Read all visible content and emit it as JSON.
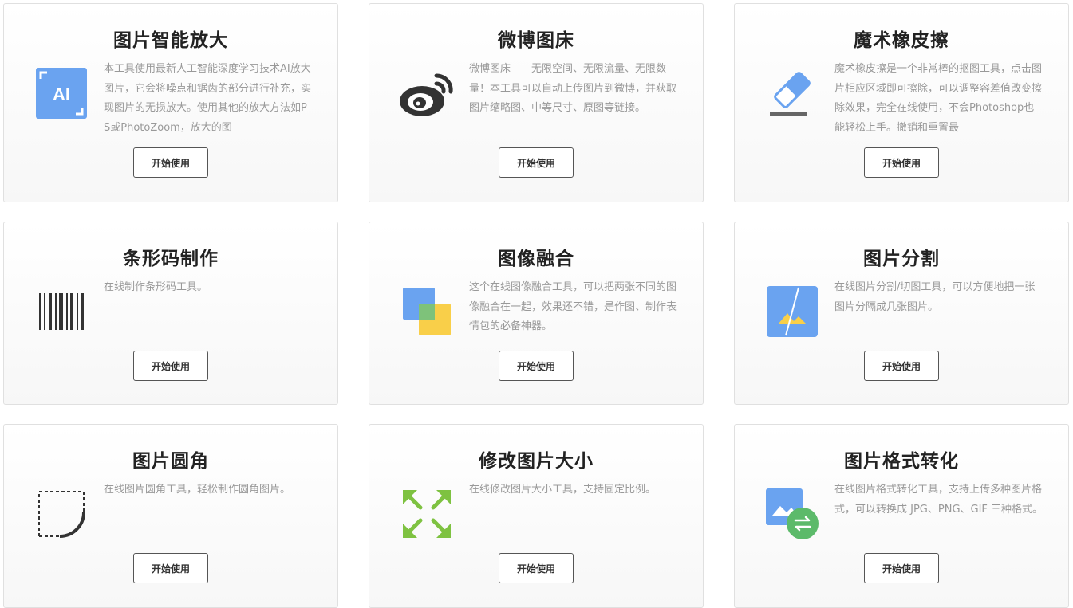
{
  "tools": [
    {
      "title": "图片智能放大",
      "icon": "ai-upscale-icon",
      "description": "本工具使用最新人工智能深度学习技术AI放大图片，它会将噪点和锯齿的部分进行补充，实现图片的无损放大。使用其他的放大方法如PS或PhotoZoom，放大的图",
      "button": "开始使用"
    },
    {
      "title": "微博图床",
      "icon": "weibo-icon",
      "description": "微博图床——无限空间、无限流量、无限数量！本工具可以自动上传图片到微博，并获取图片缩略图、中等尺寸、原图等链接。",
      "button": "开始使用"
    },
    {
      "title": "魔术橡皮擦",
      "icon": "eraser-icon",
      "description": "魔术橡皮擦是一个非常棒的抠图工具，点击图片相应区域即可擦除，可以调整容差值改变擦除效果，完全在线使用，不会Photoshop也能轻松上手。撤销和重置最",
      "button": "开始使用"
    },
    {
      "title": "条形码制作",
      "icon": "barcode-icon",
      "description": "在线制作条形码工具。",
      "button": "开始使用"
    },
    {
      "title": "图像融合",
      "icon": "image-blend-icon",
      "description": "这个在线图像融合工具，可以把两张不同的图像融合在一起，效果还不错，是作图、制作表情包的必备神器。",
      "button": "开始使用"
    },
    {
      "title": "图片分割",
      "icon": "image-split-icon",
      "description": "在线图片分割/切图工具，可以方便地把一张图片分隔成几张图片。",
      "button": "开始使用"
    },
    {
      "title": "图片圆角",
      "icon": "rounded-corner-icon",
      "description": "在线图片圆角工具，轻松制作圆角图片。",
      "button": "开始使用"
    },
    {
      "title": "修改图片大小",
      "icon": "resize-arrows-icon",
      "description": "在线修改图片大小工具，支持固定比例。",
      "button": "开始使用"
    },
    {
      "title": "图片格式转化",
      "icon": "format-convert-icon",
      "description": "在线图片格式转化工具，支持上传多种图片格式，可以转换成 JPG、PNG、GIF 三种格式。",
      "button": "开始使用"
    }
  ],
  "colors": {
    "blue": "#6aa3f0",
    "yellow": "#f9cf49",
    "green": "#7ec241",
    "convert_green": "#5cba6a",
    "dark": "#333333"
  }
}
